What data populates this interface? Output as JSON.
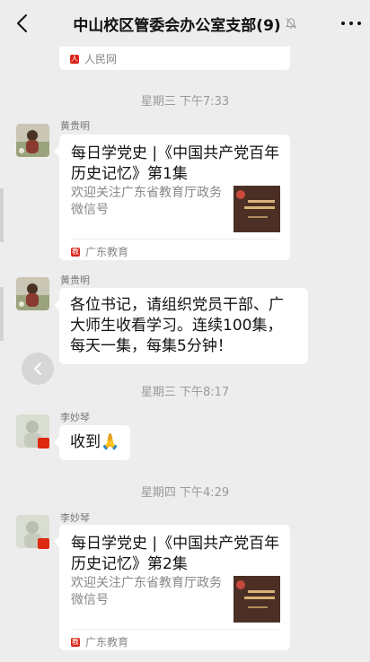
{
  "header": {
    "title": "中山校区管委会办公室支部(9)"
  },
  "prev_card_tail": {
    "source": "人民网"
  },
  "messages": [
    {
      "time": "星期三 下午7:33"
    },
    {
      "sender": "黄贵明",
      "card": {
        "title": "每日学党史 |《中国共产党百年历史记忆》第1集",
        "desc": "欢迎关注广东省教育厅政务微信号",
        "source": "广东教育"
      }
    },
    {
      "sender": "黄贵明",
      "text": "各位书记，请组织党员干部、广大师生收看学习。连续100集，每天一集，每集5分钟！"
    },
    {
      "time": "星期三 下午8:17"
    },
    {
      "sender": "李妙琴",
      "text": "收到🙏"
    },
    {
      "time": "星期四 下午4:29"
    },
    {
      "sender": "李妙琴",
      "card": {
        "title": "每日学党史 |《中国共产党百年历史记忆》第2集",
        "desc": "欢迎关注广东省教育厅政务微信号",
        "source": "广东教育"
      }
    }
  ],
  "colors": {
    "background": "#ededed",
    "bubble": "#ffffff",
    "time_text": "#9a9a9a",
    "source_icon": "#d9241b"
  },
  "icons": [
    "back-arrow-icon",
    "mute-bell-icon",
    "more-icon",
    "source-logo-icon",
    "collapse-arrow-icon"
  ]
}
